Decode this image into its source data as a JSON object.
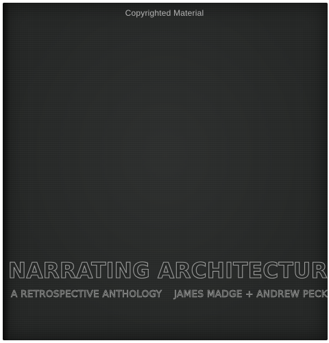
{
  "watermark": "Copyrighted Material",
  "cover": {
    "title": "NARRATING ARCHITECTURE",
    "subtitle": "A RETROSPECTIVE ANTHOLOGY",
    "authors": "JAMES MADGE + ANDREW PECKHAM",
    "background_color": "#262827",
    "lettering_color": "#9a9b9a"
  }
}
